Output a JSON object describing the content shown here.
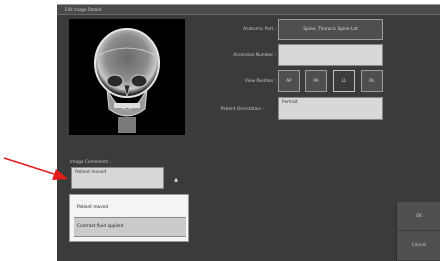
{
  "window": {
    "title": "Edit Image Details"
  },
  "form": {
    "anatomic_part_label": "Anatomic Part :",
    "anatomic_part_value": "Spine, Thoracic Spine Lat",
    "accession_label": "Accession Number :",
    "accession_value": "",
    "view_position_label": "View Position :",
    "view_positions": [
      "AP",
      "PA",
      "LL",
      "RL"
    ],
    "view_position_selected": "LL",
    "orientation_label": "Patient Orientation :",
    "orientation_value": "Portrait",
    "image_comments_label": "Image Comments :",
    "image_comments_value": "Patient moved"
  },
  "dropdown": {
    "arrow": "▲",
    "options": [
      "Patient moved",
      "Contrast fluid applied"
    ]
  },
  "actions": {
    "ok": "OK",
    "cancel": "Cancel"
  },
  "colors": {
    "annotation_arrow": "#e31b1b",
    "window_bg": "#3b3b3b"
  }
}
